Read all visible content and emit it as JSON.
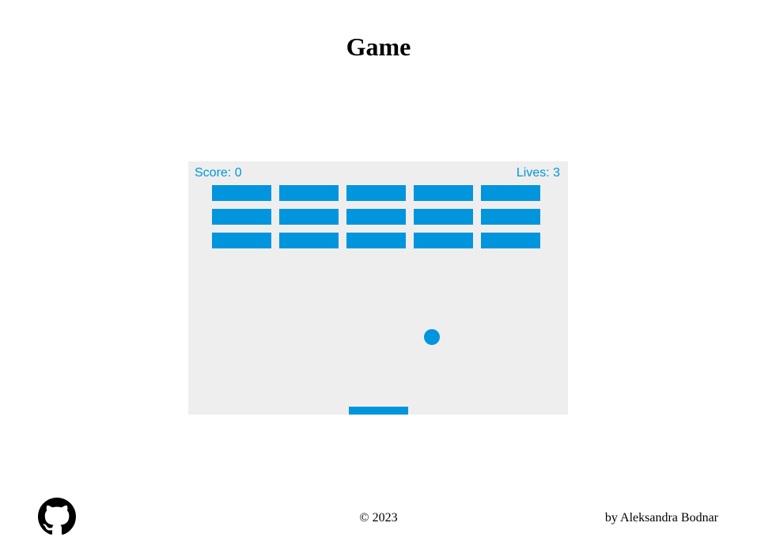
{
  "page": {
    "title": "Game"
  },
  "game": {
    "score_text": "Score: 0",
    "lives_text": "Lives: 3",
    "score": 0,
    "lives": 3,
    "brick_rows": 3,
    "brick_columns": 5,
    "colors": {
      "accent": "#0095dd",
      "canvas_background": "#eeeeee"
    }
  },
  "footer": {
    "github_icon": "github-icon",
    "copyright": "© 2023",
    "author": "by Aleksandra Bodnar"
  }
}
